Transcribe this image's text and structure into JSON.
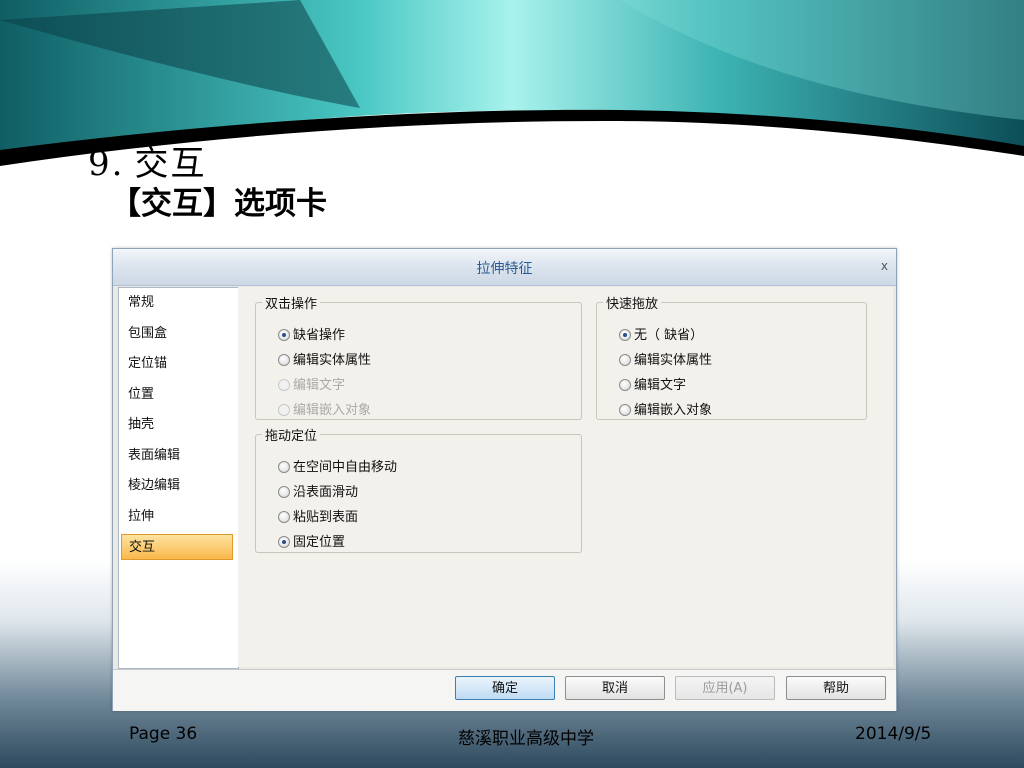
{
  "slide": {
    "title_number": "9.",
    "title": "交互",
    "subtitle": "【交互】选项卡",
    "footer": {
      "page": "Page 36",
      "school": "慈溪职业高级中学",
      "date": "2014/9/5"
    }
  },
  "dialog": {
    "title": "拉伸特征",
    "close_glyph": "x",
    "nav_items": [
      {
        "label": "常规",
        "active": false
      },
      {
        "label": "包围盒",
        "active": false
      },
      {
        "label": "定位锚",
        "active": false
      },
      {
        "label": "位置",
        "active": false
      },
      {
        "label": "抽壳",
        "active": false
      },
      {
        "label": "表面编辑",
        "active": false
      },
      {
        "label": "棱边编辑",
        "active": false
      },
      {
        "label": "拉伸",
        "active": false
      },
      {
        "label": "交互",
        "active": true
      }
    ],
    "double_click": {
      "legend": "双击操作",
      "options": [
        {
          "label": "缺省操作",
          "checked": true,
          "enabled": true
        },
        {
          "label": "编辑实体属性",
          "checked": false,
          "enabled": true
        },
        {
          "label": "编辑文字",
          "checked": false,
          "enabled": false
        },
        {
          "label": "编辑嵌入对象",
          "checked": false,
          "enabled": false
        }
      ]
    },
    "quick_drag": {
      "legend": "快速拖放",
      "options": [
        {
          "label": "无（ 缺省）",
          "checked": true,
          "enabled": true
        },
        {
          "label": "编辑实体属性",
          "checked": false,
          "enabled": true
        },
        {
          "label": "编辑文字",
          "checked": false,
          "enabled": true
        },
        {
          "label": "编辑嵌入对象",
          "checked": false,
          "enabled": true
        }
      ]
    },
    "drag_position": {
      "legend": "拖动定位",
      "options": [
        {
          "label": "在空间中自由移动",
          "checked": false,
          "enabled": true
        },
        {
          "label": "沿表面滑动",
          "checked": false,
          "enabled": true
        },
        {
          "label": "粘贴到表面",
          "checked": false,
          "enabled": true
        },
        {
          "label": "固定位置",
          "checked": true,
          "enabled": true
        }
      ]
    },
    "buttons": {
      "ok": "确定",
      "cancel": "取消",
      "apply": "应用(A)",
      "help": "帮助"
    }
  },
  "colors": {
    "title_blue": "#2c5b93",
    "active_tab": "#f9b84c",
    "banner_teal": "#1e8f95"
  }
}
